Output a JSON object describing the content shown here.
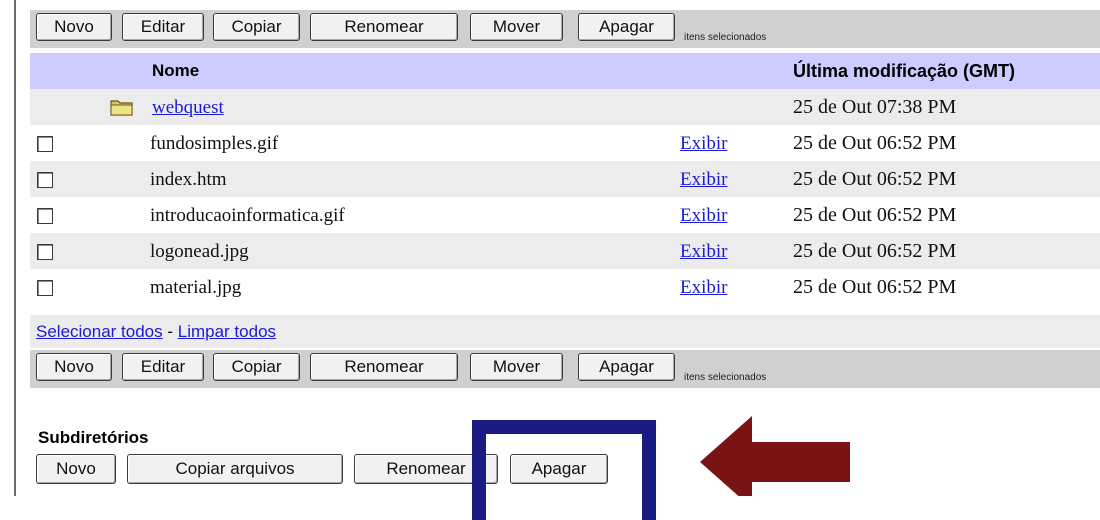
{
  "toolbar": {
    "buttons": [
      "Novo",
      "Editar",
      "Copiar",
      "Renomear",
      "Mover",
      "Apagar"
    ],
    "selected_label": "itens selecionados"
  },
  "table": {
    "headers": {
      "name": "Nome",
      "modified": "Última modificação (GMT)"
    },
    "folder": {
      "name": "webquest",
      "date": "25 de Out 07:38 PM"
    },
    "files": [
      {
        "name": "fundosimples.gif",
        "action": "Exibir",
        "date": "25 de Out 06:52 PM"
      },
      {
        "name": "index.htm",
        "action": "Exibir",
        "date": "25 de Out 06:52 PM"
      },
      {
        "name": "introducaoinformatica.gif",
        "action": "Exibir",
        "date": "25 de Out 06:52 PM"
      },
      {
        "name": "logonead.jpg",
        "action": "Exibir",
        "date": "25 de Out 06:52 PM"
      },
      {
        "name": "material.jpg",
        "action": "Exibir",
        "date": "25 de Out 06:52 PM"
      }
    ]
  },
  "selection": {
    "select_all": "Selecionar todos",
    "separator": " - ",
    "clear_all": "Limpar todos"
  },
  "subdirs": {
    "title": "Subdiretórios",
    "buttons": [
      "Novo",
      "Copiar arquivos",
      "Renomear",
      "Apagar"
    ]
  },
  "icons": {
    "folder": "folder-icon",
    "annotation_arrow": "arrow-left-icon"
  },
  "colors": {
    "toolbar_bg": "#d0d0d0",
    "header_bg": "#ccccff",
    "alt_row_bg": "#ececec",
    "link": "#1a1ad8",
    "highlight_box": "#1a1a80",
    "annotation_arrow": "#7a1414"
  }
}
